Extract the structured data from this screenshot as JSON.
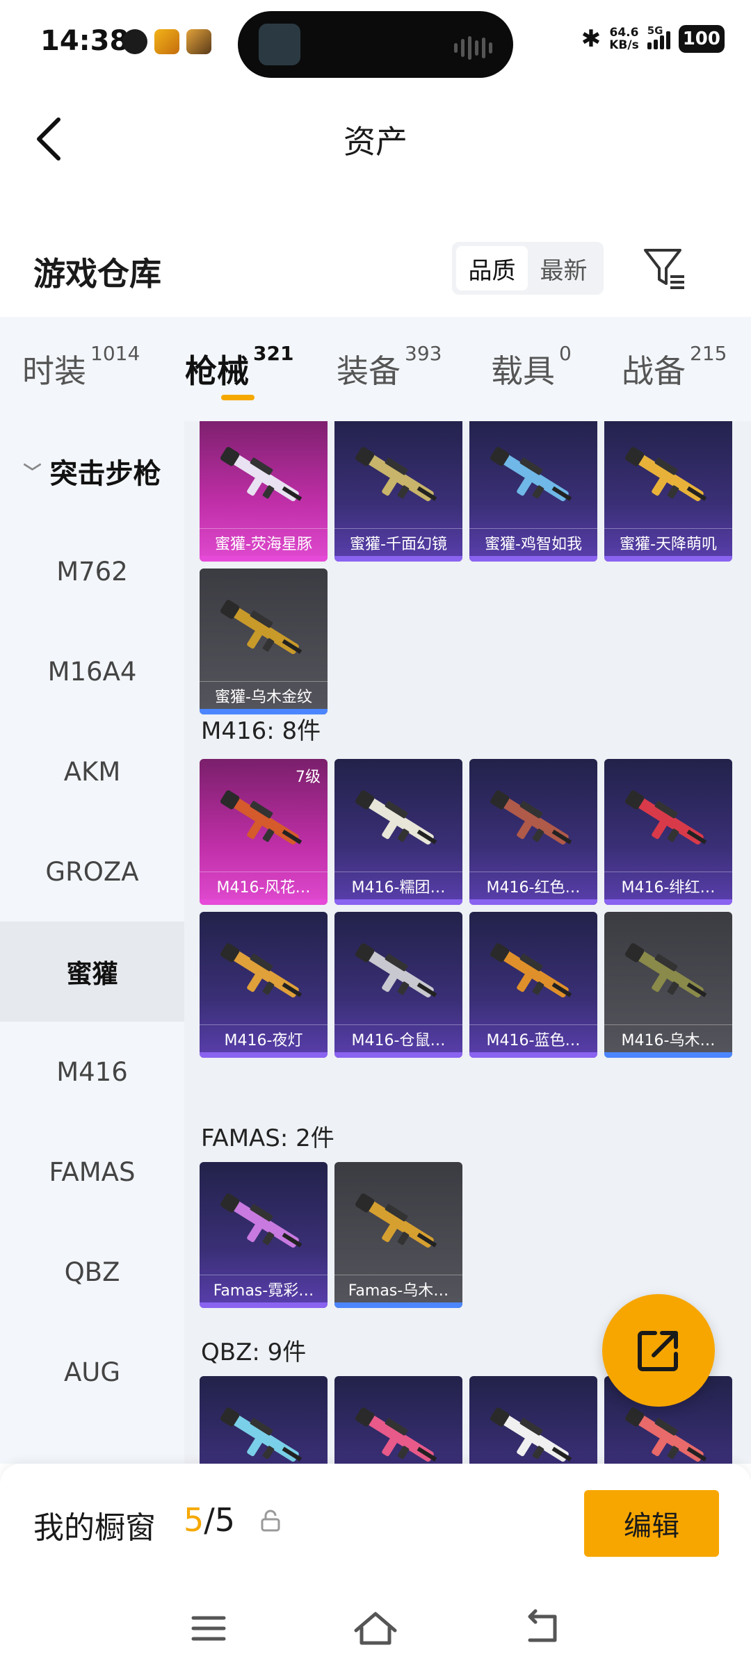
{
  "status_bar": {
    "time": "14:38",
    "net_speed_value": "64.6",
    "net_speed_unit": "KB/s",
    "network": "5G",
    "battery": "100"
  },
  "header": {
    "title": "资产"
  },
  "warehouse": {
    "title": "游戏仓库",
    "sort_options": [
      "品质",
      "最新"
    ],
    "active_sort": "品质"
  },
  "tabs": [
    {
      "label": "时装",
      "count": "1014"
    },
    {
      "label": "枪械",
      "count": "321"
    },
    {
      "label": "装备",
      "count": "393"
    },
    {
      "label": "载具",
      "count": "0"
    },
    {
      "label": "战备",
      "count": "215"
    }
  ],
  "active_tab": "枪械",
  "sidebar": {
    "category": "突击步枪",
    "items": [
      "M762",
      "M16A4",
      "AKM",
      "GROZA",
      "蜜獾",
      "M416",
      "FAMAS",
      "QBZ",
      "AUG"
    ],
    "active_item": "蜜獾"
  },
  "sections": [
    {
      "title": "",
      "items": [
        {
          "name": "蜜獾-荧海星豚",
          "rarity": "pink"
        },
        {
          "name": "蜜獾-千面幻镜",
          "rarity": "purple"
        },
        {
          "name": "蜜獾-鸡智如我",
          "rarity": "purple"
        },
        {
          "name": "蜜獾-天降萌叽",
          "rarity": "purple"
        },
        {
          "name": "蜜獾-乌木金纹",
          "rarity": "gray"
        }
      ]
    },
    {
      "title": "M416: 8件",
      "items": [
        {
          "name": "M416-风花…",
          "rarity": "pink",
          "level": "7级"
        },
        {
          "name": "M416-糯团…",
          "rarity": "purple"
        },
        {
          "name": "M416-红色…",
          "rarity": "purple"
        },
        {
          "name": "M416-绯红…",
          "rarity": "purple"
        },
        {
          "name": "M416-夜灯",
          "rarity": "purple"
        },
        {
          "name": "M416-仓鼠…",
          "rarity": "purple"
        },
        {
          "name": "M416-蓝色…",
          "rarity": "purple"
        },
        {
          "name": "M416-乌木…",
          "rarity": "gray"
        }
      ]
    },
    {
      "title": "FAMAS: 2件",
      "items": [
        {
          "name": "Famas-霓彩…",
          "rarity": "purple"
        },
        {
          "name": "Famas-乌木…",
          "rarity": "gray"
        }
      ]
    },
    {
      "title": "QBZ: 9件",
      "items": [
        {
          "name": "",
          "rarity": "purple"
        },
        {
          "name": "",
          "rarity": "purple"
        },
        {
          "name": "",
          "rarity": "purple"
        },
        {
          "name": "",
          "rarity": "purple"
        }
      ]
    }
  ],
  "showcase": {
    "label": "我的橱窗",
    "current": "5",
    "total": "/5"
  },
  "edit_button": {
    "label": "编辑"
  },
  "colors": {
    "accent": "#f7a600",
    "purple_card": "#3a2f76",
    "pink_card": "#c02fa8",
    "gray_card": "#55555d"
  }
}
